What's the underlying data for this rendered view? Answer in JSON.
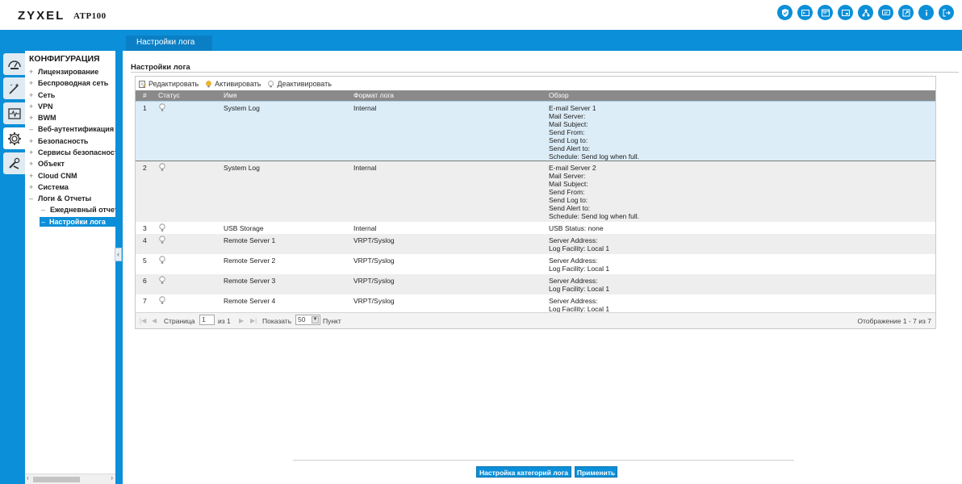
{
  "brand": {
    "logo": "ZYXEL",
    "model": "ATP100"
  },
  "top_icons": [
    "shield-icon",
    "console-icon",
    "cli-icon",
    "window-icon",
    "sitemap-icon",
    "chat-icon",
    "export-icon",
    "info-icon",
    "logout-icon"
  ],
  "page_tab": "Настройки лога",
  "rail": [
    "dashboard-icon",
    "wizard-icon",
    "monitor-icon",
    "gear-icon",
    "tools-icon"
  ],
  "nav": {
    "title": "КОНФИГУРАЦИЯ",
    "items": [
      {
        "pm": "+",
        "label": "Лицензирование"
      },
      {
        "pm": "+",
        "label": "Беспроводная сеть"
      },
      {
        "pm": "+",
        "label": "Сеть"
      },
      {
        "pm": "+",
        "label": "VPN"
      },
      {
        "pm": "+",
        "label": "BWM"
      },
      {
        "pm": "–",
        "label": "Веб-аутентификация"
      },
      {
        "pm": "+",
        "label": "Безопасность"
      },
      {
        "pm": "+",
        "label": "Сервисы безопасности"
      },
      {
        "pm": "+",
        "label": "Объект"
      },
      {
        "pm": "+",
        "label": "Cloud CNM"
      },
      {
        "pm": "+",
        "label": "Система"
      },
      {
        "pm": "–",
        "label": "Логи & Отчеты"
      }
    ],
    "sub_items": [
      {
        "pm": "–",
        "label": "Ежедневный отчет"
      },
      {
        "pm": "–",
        "label": "Настройки лога"
      }
    ]
  },
  "section_title": "Настройки лога",
  "toolbar": {
    "edit": "Редактировать",
    "activate": "Активировать",
    "deactivate": "Деактивировать"
  },
  "columns": {
    "num": "#",
    "status": "Статус",
    "name": "Имя",
    "format": "Формат лога",
    "summary": "Обзор"
  },
  "rows": [
    {
      "num": "1",
      "name": "System Log",
      "format": "Internal",
      "summary": [
        "E-mail Server 1",
        "Mail Server:",
        "Mail Subject:",
        "Send From:",
        "Send Log to:",
        "Send Alert to:",
        "Schedule: Send log when full."
      ]
    },
    {
      "num": "2",
      "name": "System Log",
      "format": "Internal",
      "summary": [
        "E-mail Server 2",
        "Mail Server:",
        "Mail Subject:",
        "Send From:",
        "Send Log to:",
        "Send Alert to:",
        "Schedule: Send log when full."
      ]
    },
    {
      "num": "3",
      "name": "USB Storage",
      "format": "Internal",
      "summary": [
        "USB Status: none"
      ]
    },
    {
      "num": "4",
      "name": "Remote Server 1",
      "format": "VRPT/Syslog",
      "summary": [
        "Server Address:",
        "Log Facility: Local 1"
      ]
    },
    {
      "num": "5",
      "name": "Remote Server 2",
      "format": "VRPT/Syslog",
      "summary": [
        "Server Address:",
        "Log Facility: Local 1"
      ]
    },
    {
      "num": "6",
      "name": "Remote Server 3",
      "format": "VRPT/Syslog",
      "summary": [
        "Server Address:",
        "Log Facility: Local 1"
      ]
    },
    {
      "num": "7",
      "name": "Remote Server 4",
      "format": "VRPT/Syslog",
      "summary": [
        "Server Address:",
        "Log Facility: Local 1"
      ]
    }
  ],
  "pager": {
    "page_label": "Страница",
    "page_value": "1",
    "of_label": "из 1",
    "show_label": "Показать",
    "show_value": "50",
    "items_label": "Пункт",
    "display_text": "Отображение 1 - 7 из 7"
  },
  "buttons": {
    "category": "Настройка категорий лога",
    "apply": "Применить"
  },
  "colors": {
    "accent": "#0b8fd8",
    "selected_row": "#dcedf8",
    "header_row": "#8a8a8a"
  }
}
